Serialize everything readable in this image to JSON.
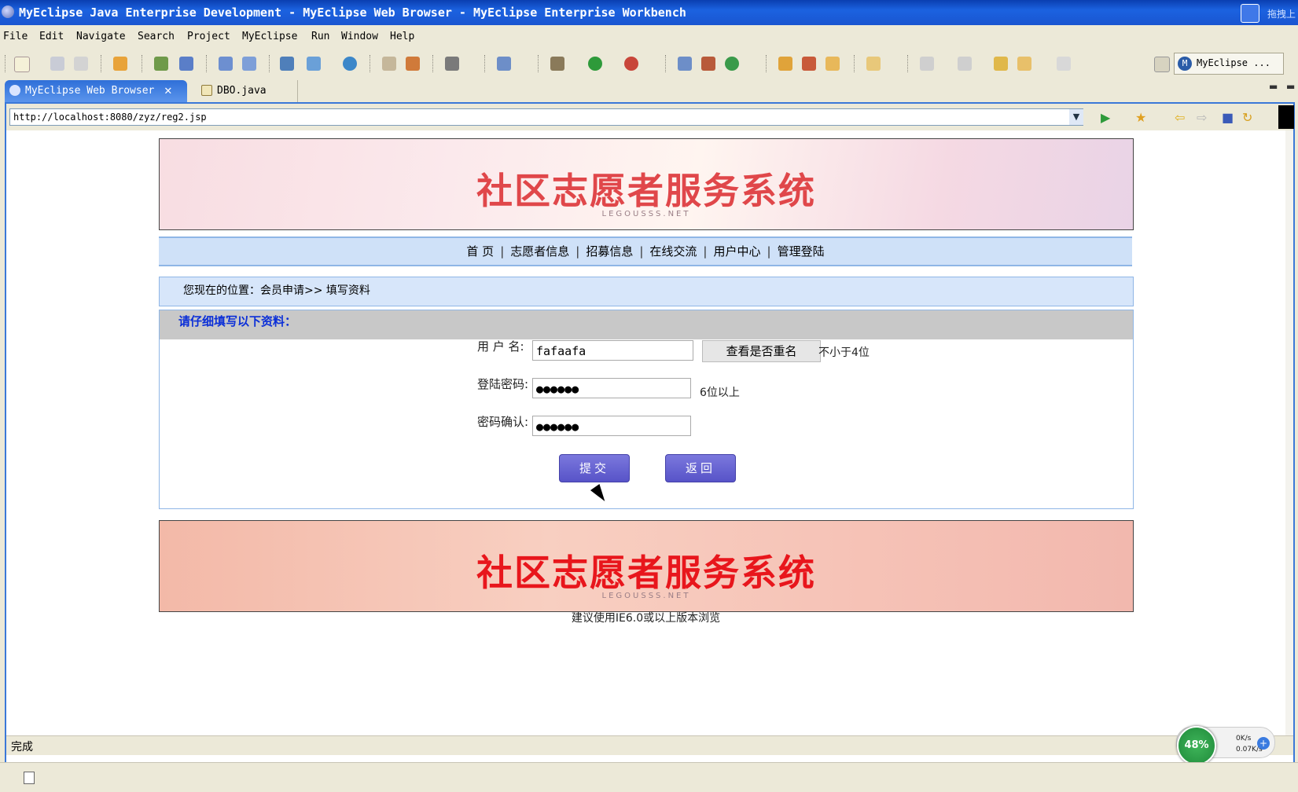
{
  "window": {
    "title": "MyEclipse Java Enterprise Development - MyEclipse Web Browser - MyEclipse Enterprise Workbench",
    "tray_label": "拖拽上"
  },
  "menu": [
    "File",
    "Edit",
    "Navigate",
    "Search",
    "Project",
    "MyEclipse",
    "Run",
    "Window",
    "Help"
  ],
  "perspective": {
    "label": "MyEclipse ..."
  },
  "tabs": [
    {
      "label": "MyEclipse Web Browser",
      "active": true,
      "close": "✕"
    },
    {
      "label": "DBO.java",
      "active": false
    }
  ],
  "address": {
    "url": "http://localhost:8080/zyz/reg2.jsp"
  },
  "page": {
    "banner_title": "社区志愿者服务系统",
    "banner_sub": "LEGOUSSS.NET",
    "nav": [
      "首 页",
      "志愿者信息",
      "招募信息",
      "在线交流",
      "用户中心",
      "管理登陆"
    ],
    "breadcrumb": "您现在的位置：会员申请>> 填写资料",
    "form_heading": "请仔细填写以下资料：",
    "fields": {
      "username_label": "用 户 名:",
      "username_value": "fafaafa",
      "check_button": "查看是否重名",
      "username_hint": "不小于4位",
      "password_label": "登陆密码:",
      "password_value": "●●●●●●",
      "password_hint": "6位以上",
      "confirm_label": "密码确认:",
      "confirm_value": "●●●●●●"
    },
    "submit_label": "提交",
    "back_label": "返回",
    "footer_banner_title": "社区志愿者服务系统",
    "footer_banner_sub": "LEGOUSSS.NET",
    "footer_note": "建议使用IE6.0或以上版本浏览"
  },
  "status": {
    "text": "完成"
  },
  "speed": {
    "percent": "48%",
    "up": "0K/s",
    "down": "0.07K/s"
  },
  "colors": {
    "title_bar": "#1b62e0",
    "nav_bg": "#cfe1f8",
    "button": "#5b57cc",
    "banner_text": "#e0474a"
  }
}
